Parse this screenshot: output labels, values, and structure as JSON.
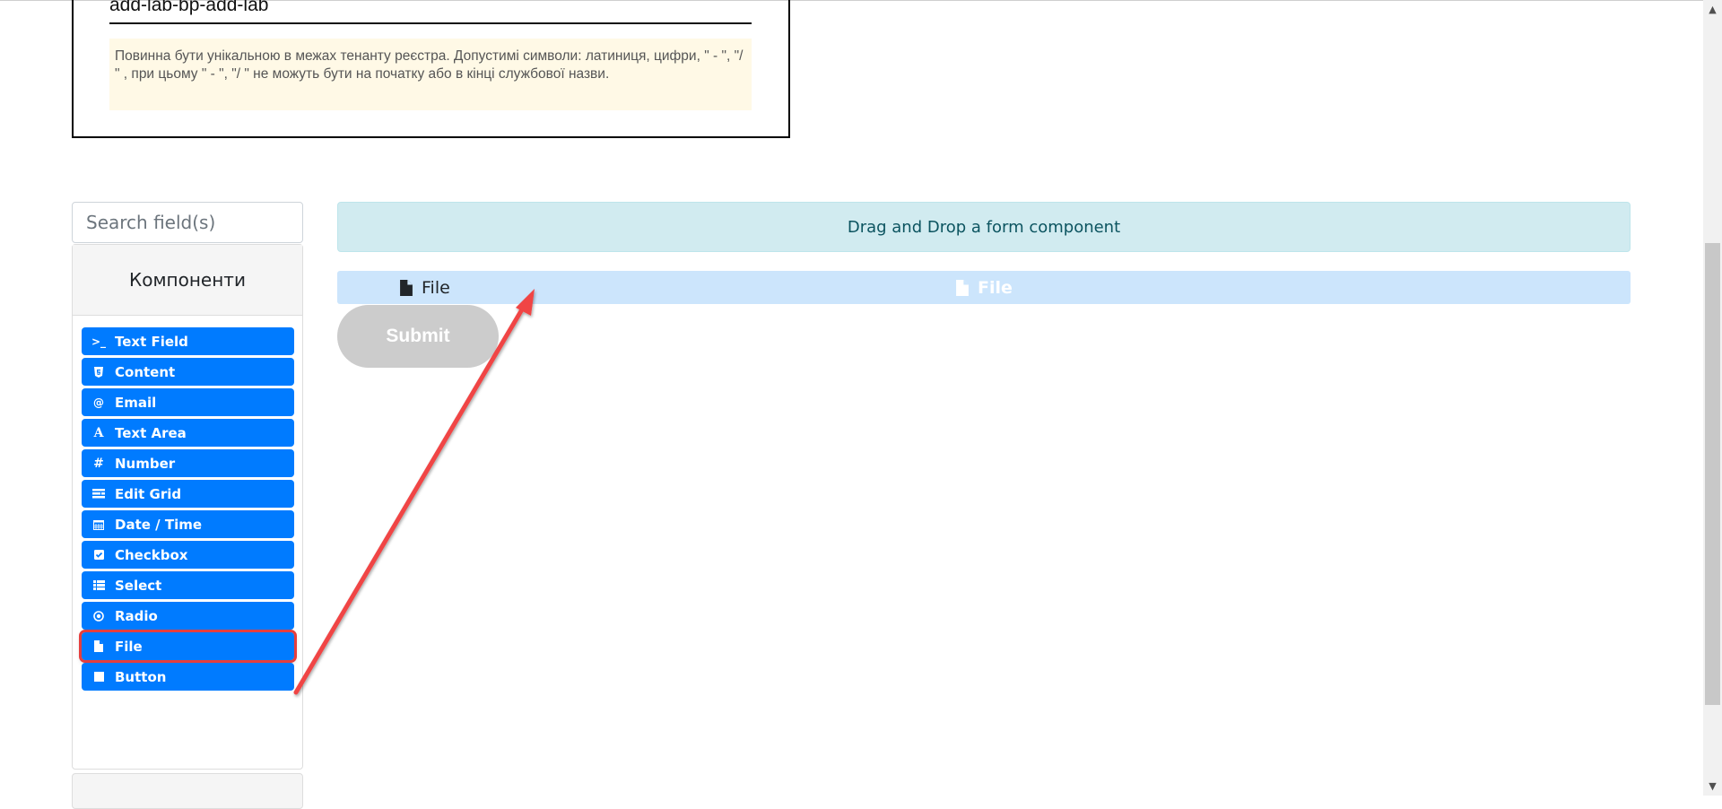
{
  "form_name": {
    "value": "add-lab-bp-add-lab",
    "hint": "Повинна бути унікальною в межах тенанту реєстра. Допустимі символи: латиниця, цифри, \" - \", \"/ \" , при цьому  \" - \", \"/ \" не можуть бути на початку або в кінці службової назви."
  },
  "sidebar": {
    "search_placeholder": "Search field(s)",
    "panel_title": "Компоненти",
    "components": [
      {
        "label": "Text Field",
        "icon": "terminal-icon"
      },
      {
        "label": "Content",
        "icon": "html5-icon"
      },
      {
        "label": "Email",
        "icon": "at-icon"
      },
      {
        "label": "Text Area",
        "icon": "font-icon"
      },
      {
        "label": "Number",
        "icon": "hashtag-icon"
      },
      {
        "label": "Edit Grid",
        "icon": "tasks-icon"
      },
      {
        "label": "Date / Time",
        "icon": "calendar-icon"
      },
      {
        "label": "Checkbox",
        "icon": "check-square-icon"
      },
      {
        "label": "Select",
        "icon": "list-icon"
      },
      {
        "label": "Radio",
        "icon": "dot-circle-icon"
      },
      {
        "label": "File",
        "icon": "file-icon",
        "highlighted": true
      },
      {
        "label": "Button",
        "icon": "stop-icon"
      }
    ]
  },
  "builder": {
    "dropzone_text": "Drag and Drop a form component",
    "dragged_component_label": "File",
    "drag_ghost_label": "File",
    "submit_label": "Submit"
  },
  "colors": {
    "component_button": "#007bff",
    "highlight_outline": "#e53e3e",
    "dropzone_bg": "#d1ebf0",
    "drag_row_bg": "#cce5fc",
    "submit_disabled": "#cccccc",
    "hint_bg": "#fff9e6"
  }
}
